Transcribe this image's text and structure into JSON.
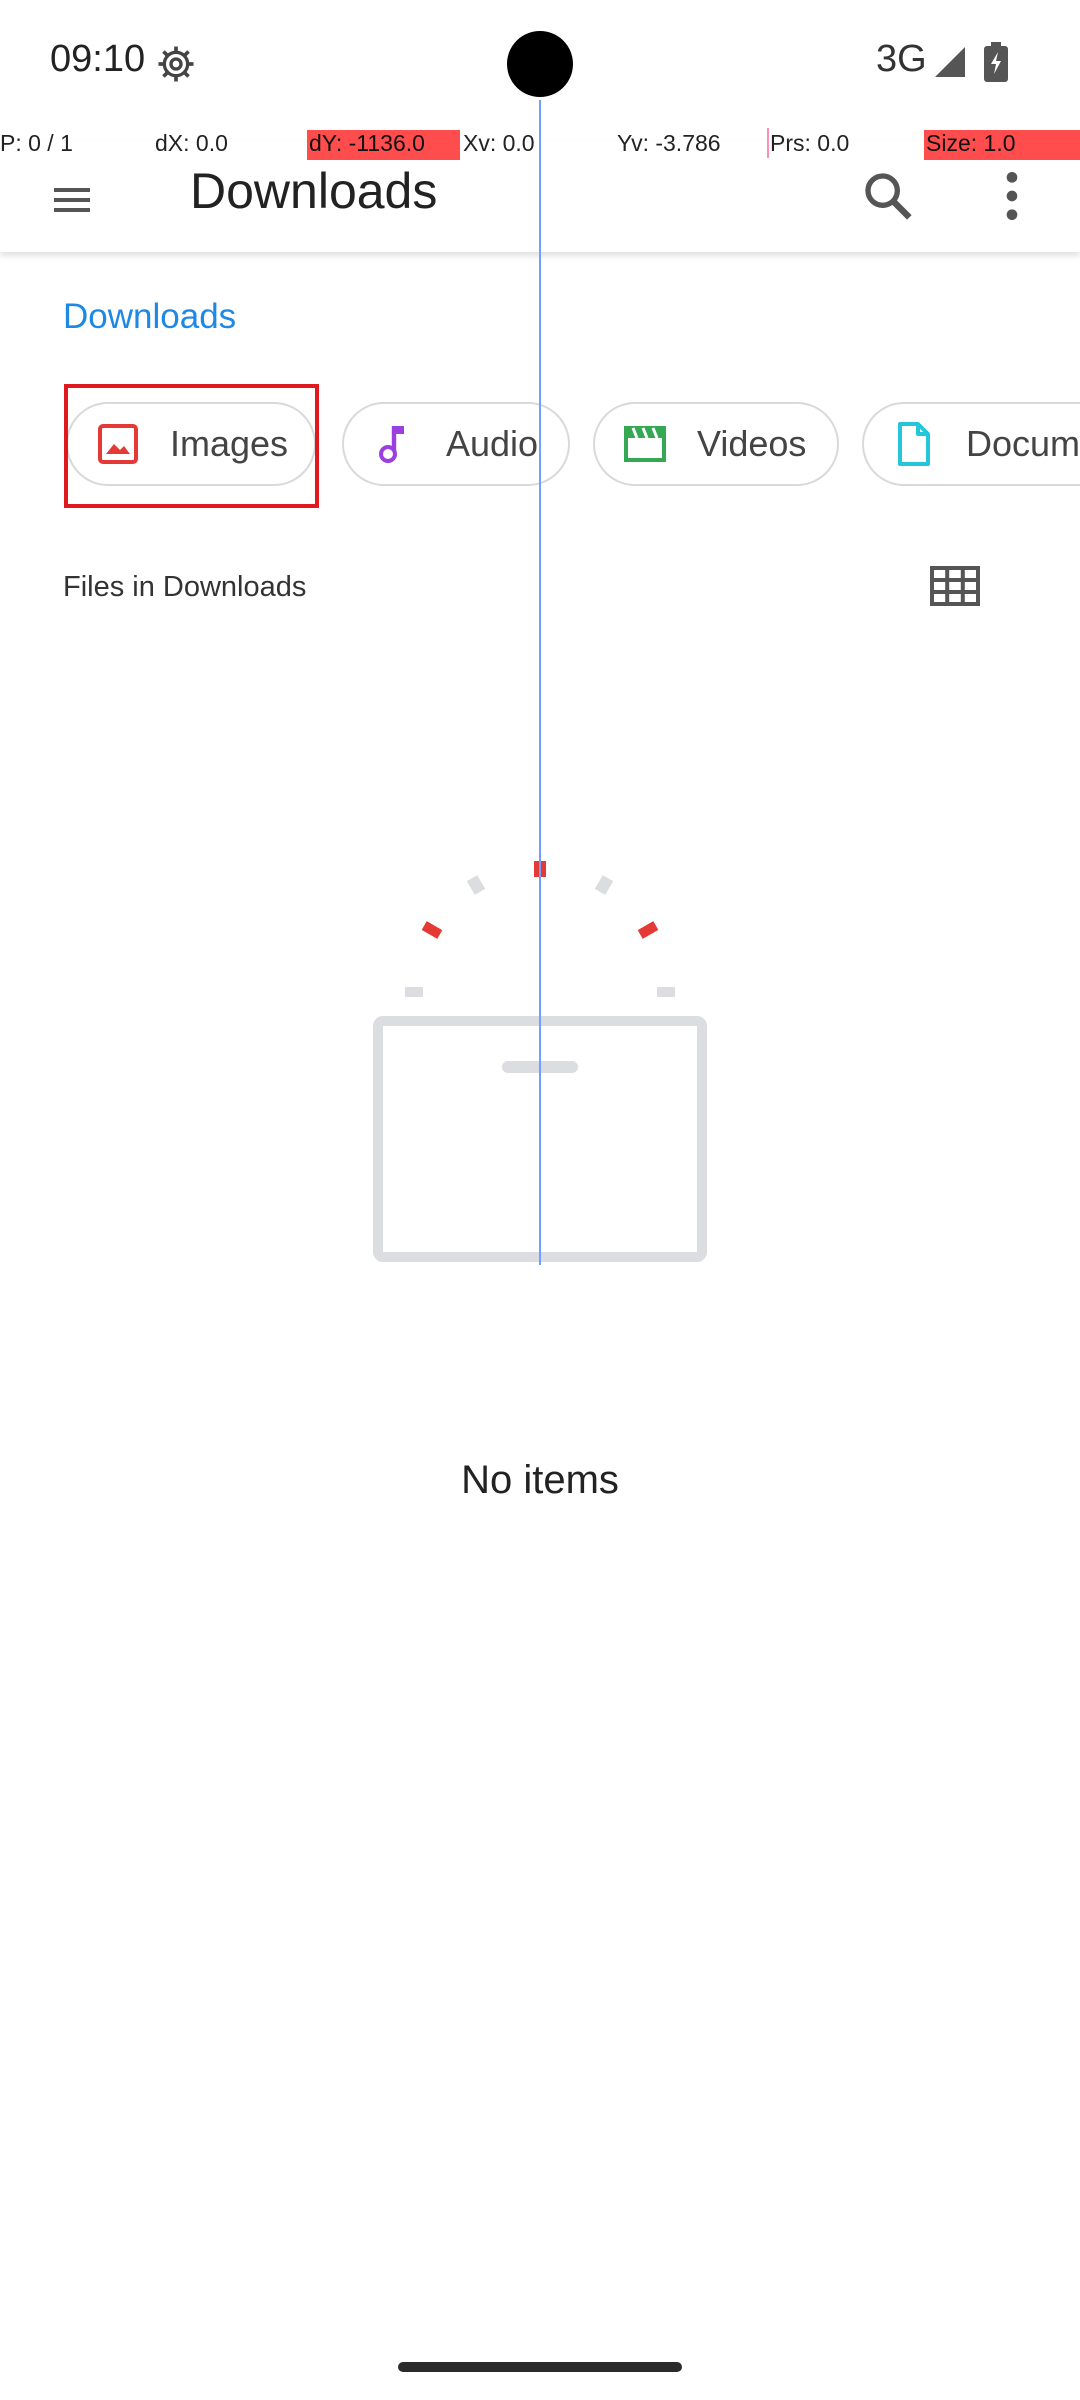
{
  "status_bar": {
    "time": "09:10",
    "network": "3G",
    "icons": [
      "gear-icon",
      "signal-icon",
      "battery-icon"
    ]
  },
  "debug_overlay": {
    "pointer": "P: 0 / 1",
    "dx": "dX: 0.0",
    "dy": "dY: -1136.0",
    "xv": "Xv: 0.0",
    "yv": "Yv: -3.786",
    "prs": "Prs: 0.0",
    "size": "Size: 1.0"
  },
  "app_bar": {
    "title": "Downloads",
    "icons": [
      "menu-icon",
      "search-icon",
      "more-vert-icon"
    ]
  },
  "breadcrumb": {
    "label": "Downloads"
  },
  "chips": [
    {
      "label": "Images",
      "icon": "image-icon",
      "color": "#e53935"
    },
    {
      "label": "Audio",
      "icon": "music-note-icon",
      "color": "#9c3fe0"
    },
    {
      "label": "Videos",
      "icon": "movie-icon",
      "color": "#34a853"
    },
    {
      "label": "Documents",
      "icon": "document-icon",
      "color": "#26c6da"
    }
  ],
  "section": {
    "title": "Files in Downloads",
    "view_toggle_icon": "grid-view-icon"
  },
  "empty_state": {
    "message": "No items"
  },
  "colors": {
    "accent": "#1e88e5",
    "highlight": "#e0191f"
  }
}
